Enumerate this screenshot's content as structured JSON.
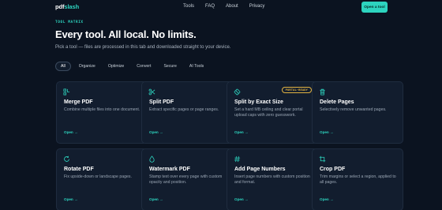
{
  "nav": {
    "logo_main": "pdf",
    "logo_accent": "slash",
    "links": [
      "Tools",
      "FAQ",
      "About",
      "Privacy"
    ],
    "cta": "Open a tool"
  },
  "hero": {
    "eyebrow": "TOOL MATRIX",
    "headline": "Every tool. All local. No limits.",
    "subhead": "Pick a tool — files are processed in this tab and downloaded straight to your device."
  },
  "tabs": [
    "All",
    "Organize",
    "Optimize",
    "Convert",
    "Secure",
    "AI Tools"
  ],
  "active_tab": "All",
  "cards": [
    {
      "icon": "merge-icon",
      "title": "Merge PDF",
      "desc": "Combine multiple files into one document.",
      "open": "Open →"
    },
    {
      "icon": "scissors-icon",
      "title": "Split PDF",
      "desc": "Extract specific pages or page ranges.",
      "open": "Open →"
    },
    {
      "icon": "split-size-icon",
      "title": "Split by Exact Size",
      "desc": "Set a hard MB ceiling and clear portal upload caps with zero guesswork.",
      "open": "Open →",
      "badge": "PORTAL-READY"
    },
    {
      "icon": "trash-icon",
      "title": "Delete Pages",
      "desc": "Selectively remove unwanted pages.",
      "open": "Open →"
    },
    {
      "icon": "rotate-icon",
      "title": "Rotate PDF",
      "desc": "Fix upside-down or landscape pages.",
      "open": "Open →"
    },
    {
      "icon": "watermark-icon",
      "title": "Watermark PDF",
      "desc": "Stamp text over every page with custom opacity and position.",
      "open": "Open →"
    },
    {
      "icon": "hash-icon",
      "title": "Add Page Numbers",
      "desc": "Insert page numbers with custom position and format.",
      "open": "Open →"
    },
    {
      "icon": "crop-icon",
      "title": "Crop PDF",
      "desc": "Trim margins or select a region, applied to all pages.",
      "open": "Open →"
    }
  ],
  "colors": {
    "accent": "#2dd4bf",
    "background": "#0b1320",
    "card": "#121d2e",
    "badge": "#e3b341"
  }
}
